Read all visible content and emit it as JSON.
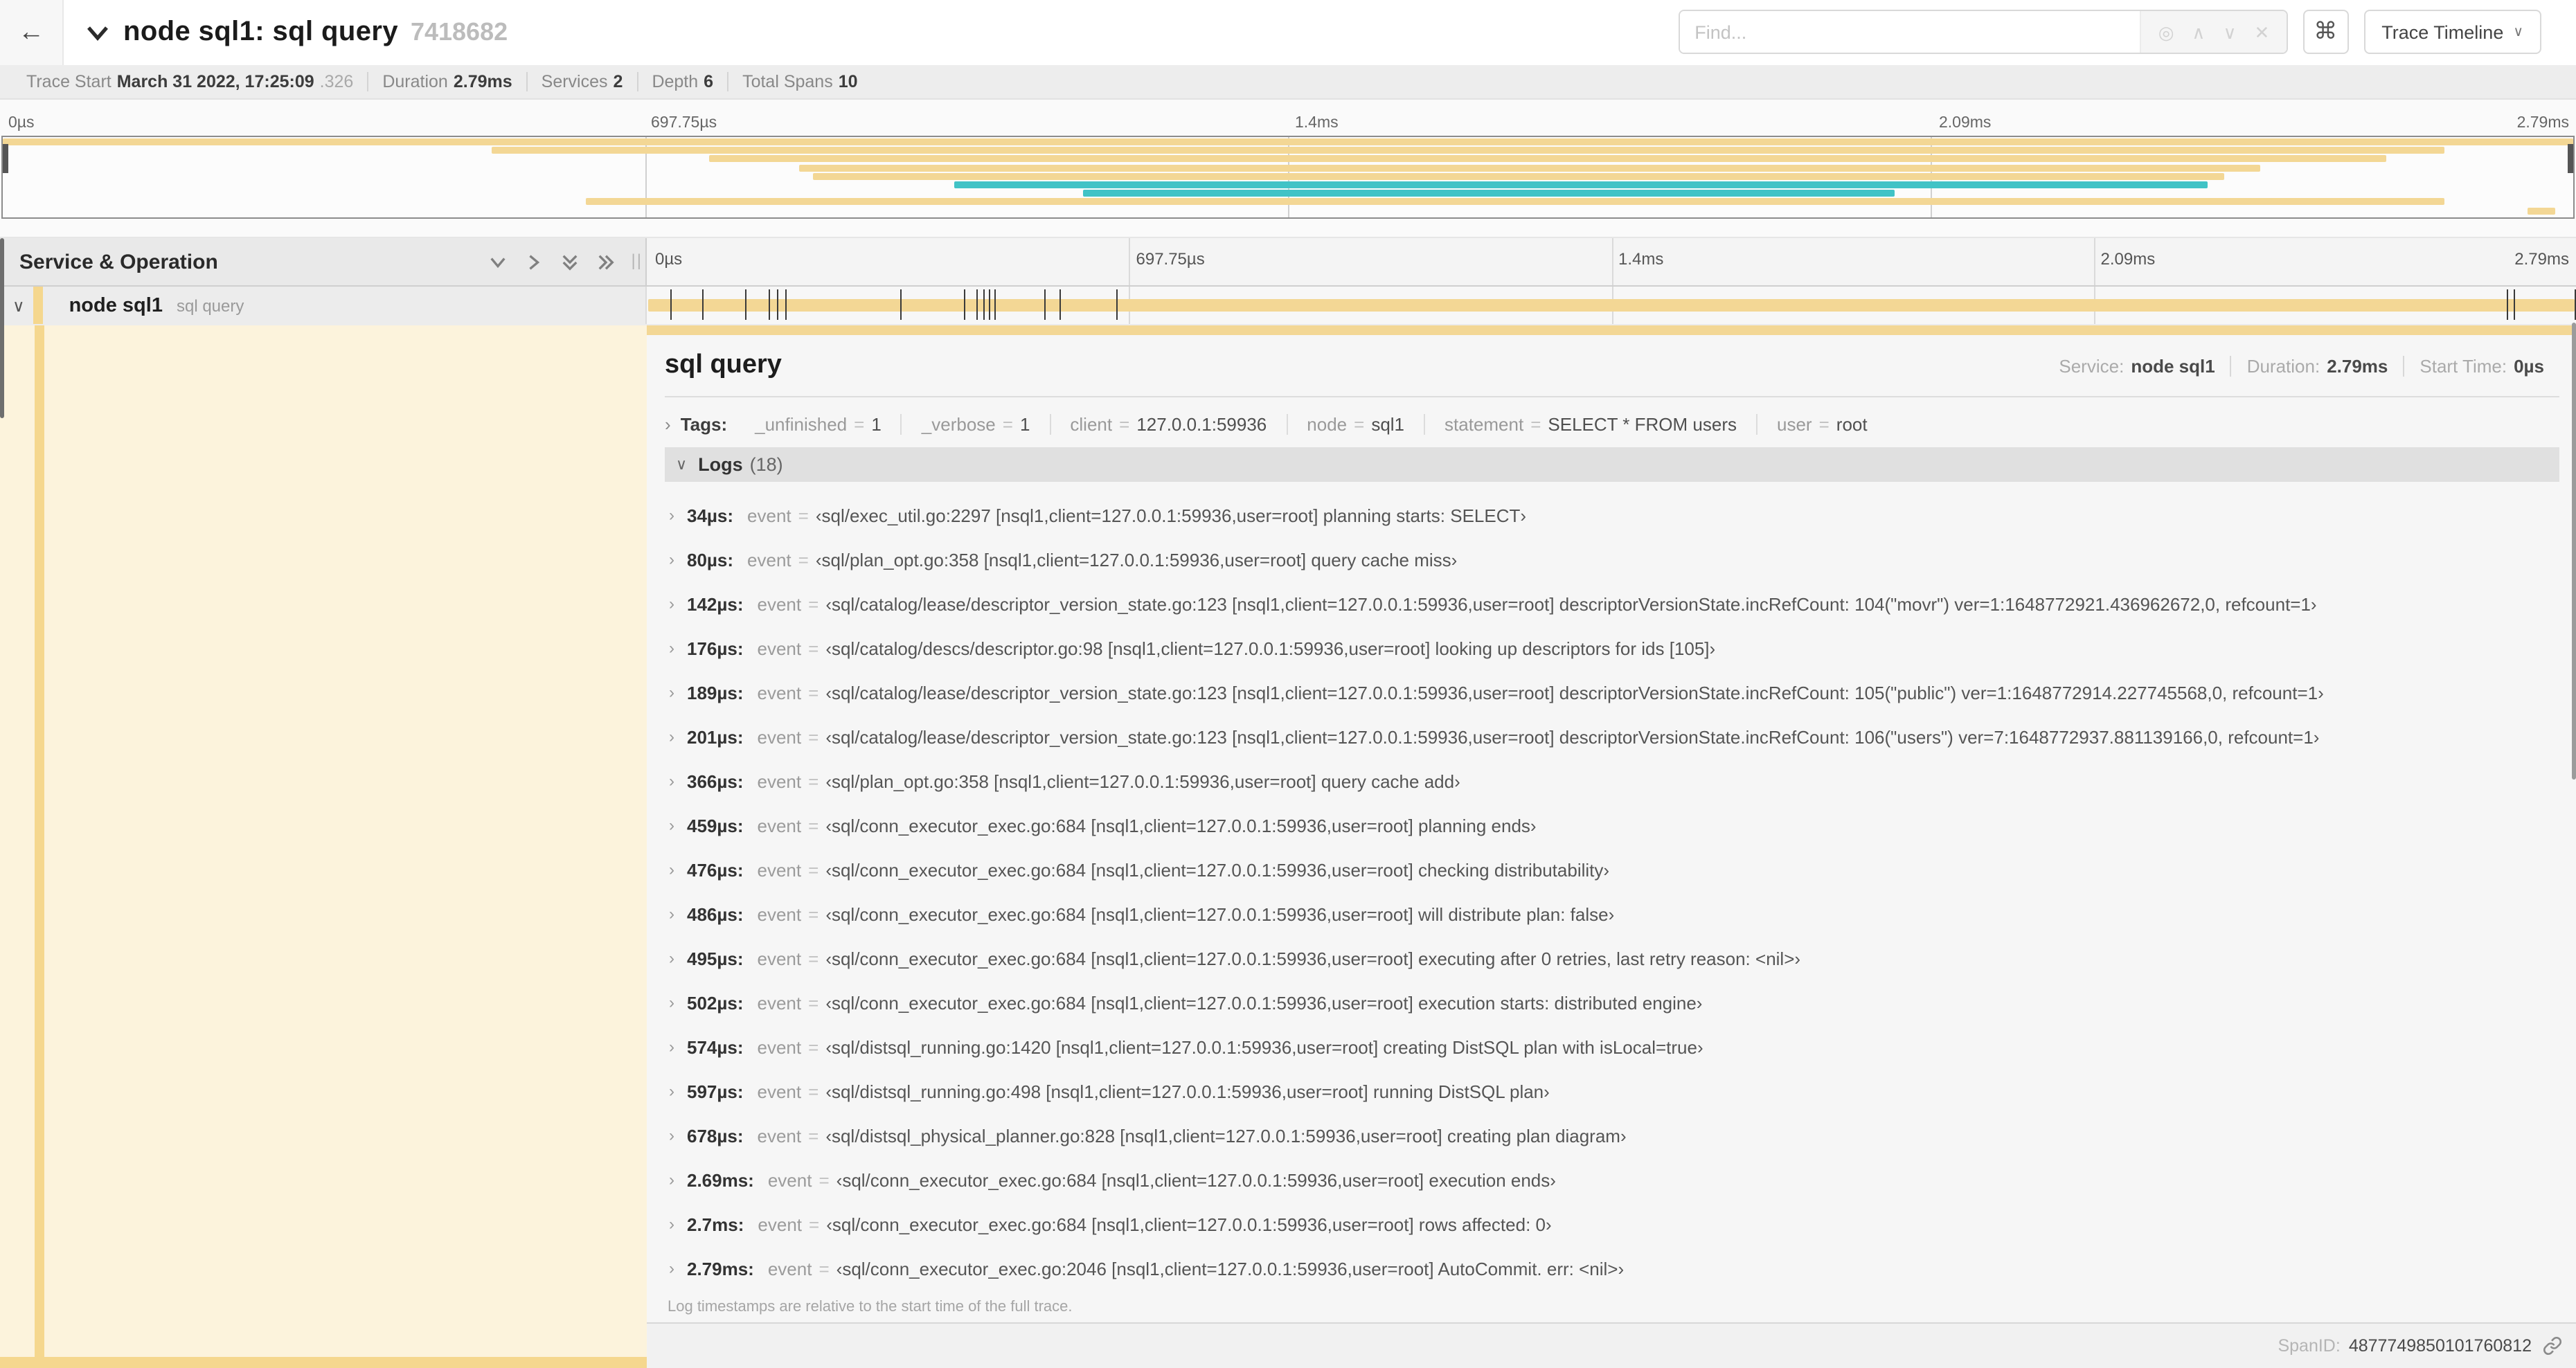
{
  "colors": {
    "tan": "#F3D795",
    "teal": "#41C3C6",
    "stripe": "#F5D78E",
    "cream": "#FCF3DC",
    "marker": "#3a3a3a"
  },
  "icons": {
    "back": "←",
    "target": "◎",
    "up": "∧",
    "down": "∨",
    "clear": "✕",
    "command": "⌘",
    "caret": "∨",
    "chevron_right": "›",
    "chevron_down": "∨"
  },
  "header": {
    "title": "node sql1: sql query",
    "trace_id": "7418682",
    "find_placeholder": "Find...",
    "view_selector": "Trace Timeline"
  },
  "trace_meta": [
    {
      "label": "Trace Start",
      "value": "March 31 2022, 17:25:09",
      "suffix": ".326"
    },
    {
      "label": "Duration",
      "value": "2.79ms",
      "suffix": ""
    },
    {
      "label": "Services",
      "value": "2",
      "suffix": ""
    },
    {
      "label": "Depth",
      "value": "6",
      "suffix": ""
    },
    {
      "label": "Total Spans",
      "value": "10",
      "suffix": ""
    }
  ],
  "ticks": [
    {
      "label": "0µs",
      "pct": 0
    },
    {
      "label": "697.75µs",
      "pct": 25
    },
    {
      "label": "1.4ms",
      "pct": 50
    },
    {
      "label": "2.09ms",
      "pct": 75
    },
    {
      "label": "2.79ms",
      "pct": 100
    }
  ],
  "minimap": {
    "spans": [
      {
        "start": 0,
        "end": 100,
        "color": "tan"
      },
      {
        "start": 19,
        "end": 95,
        "color": "tan"
      },
      {
        "start": 27.5,
        "end": 92.7,
        "color": "tan"
      },
      {
        "start": 31,
        "end": 87.8,
        "color": "tan"
      },
      {
        "start": 31.5,
        "end": 86.4,
        "color": "tan"
      },
      {
        "start": 37,
        "end": 85.8,
        "color": "teal"
      },
      {
        "start": 42,
        "end": 73.6,
        "color": "teal"
      },
      {
        "start": 22.7,
        "end": 95,
        "color": "tan"
      },
      {
        "start": 98.2,
        "end": 99.3,
        "color": "tan"
      }
    ]
  },
  "timeline": {
    "left_header": "Service & Operation",
    "row": {
      "service": "node sql1",
      "operation": "sql query"
    },
    "duration_us": 2790,
    "log_marker_us": [
      34,
      80,
      142,
      176,
      189,
      201,
      366,
      459,
      476,
      486,
      495,
      502,
      574,
      597,
      678,
      2690,
      2700,
      2790
    ]
  },
  "detail": {
    "title": "sql query",
    "eq": "=",
    "info": [
      {
        "label": "Service:",
        "value": "node sql1"
      },
      {
        "label": "Duration:",
        "value": "2.79ms"
      },
      {
        "label": "Start Time:",
        "value": "0µs"
      }
    ],
    "tags_label": "Tags:",
    "tags": [
      {
        "key": "_unfinished",
        "value": "1"
      },
      {
        "key": "_verbose",
        "value": "1"
      },
      {
        "key": "client",
        "value": "127.0.0.1:59936"
      },
      {
        "key": "node",
        "value": "sql1"
      },
      {
        "key": "statement",
        "value": "SELECT * FROM users"
      },
      {
        "key": "user",
        "value": "root"
      }
    ],
    "logs_label": "Logs",
    "logs_count": "(18)",
    "logs": [
      {
        "time": "34µs:",
        "key": "event",
        "value": "‹sql/exec_util.go:2297 [nsql1,client=127.0.0.1:59936,user=root] planning starts: SELECT›"
      },
      {
        "time": "80µs:",
        "key": "event",
        "value": "‹sql/plan_opt.go:358 [nsql1,client=127.0.0.1:59936,user=root] query cache miss›"
      },
      {
        "time": "142µs:",
        "key": "event",
        "value": "‹sql/catalog/lease/descriptor_version_state.go:123 [nsql1,client=127.0.0.1:59936,user=root] descriptorVersionState.incRefCount: 104(\"movr\") ver=1:1648772921.436962672,0, refcount=1›"
      },
      {
        "time": "176µs:",
        "key": "event",
        "value": "‹sql/catalog/descs/descriptor.go:98 [nsql1,client=127.0.0.1:59936,user=root] looking up descriptors for ids [105]›"
      },
      {
        "time": "189µs:",
        "key": "event",
        "value": "‹sql/catalog/lease/descriptor_version_state.go:123 [nsql1,client=127.0.0.1:59936,user=root] descriptorVersionState.incRefCount: 105(\"public\") ver=1:1648772914.227745568,0, refcount=1›"
      },
      {
        "time": "201µs:",
        "key": "event",
        "value": "‹sql/catalog/lease/descriptor_version_state.go:123 [nsql1,client=127.0.0.1:59936,user=root] descriptorVersionState.incRefCount: 106(\"users\") ver=7:1648772937.881139166,0, refcount=1›"
      },
      {
        "time": "366µs:",
        "key": "event",
        "value": "‹sql/plan_opt.go:358 [nsql1,client=127.0.0.1:59936,user=root] query cache add›"
      },
      {
        "time": "459µs:",
        "key": "event",
        "value": "‹sql/conn_executor_exec.go:684 [nsql1,client=127.0.0.1:59936,user=root] planning ends›"
      },
      {
        "time": "476µs:",
        "key": "event",
        "value": "‹sql/conn_executor_exec.go:684 [nsql1,client=127.0.0.1:59936,user=root] checking distributability›"
      },
      {
        "time": "486µs:",
        "key": "event",
        "value": "‹sql/conn_executor_exec.go:684 [nsql1,client=127.0.0.1:59936,user=root] will distribute plan: false›"
      },
      {
        "time": "495µs:",
        "key": "event",
        "value": "‹sql/conn_executor_exec.go:684 [nsql1,client=127.0.0.1:59936,user=root] executing after 0 retries, last retry reason: <nil>›"
      },
      {
        "time": "502µs:",
        "key": "event",
        "value": "‹sql/conn_executor_exec.go:684 [nsql1,client=127.0.0.1:59936,user=root] execution starts: distributed engine›"
      },
      {
        "time": "574µs:",
        "key": "event",
        "value": "‹sql/distsql_running.go:1420 [nsql1,client=127.0.0.1:59936,user=root] creating DistSQL plan with isLocal=true›"
      },
      {
        "time": "597µs:",
        "key": "event",
        "value": "‹sql/distsql_running.go:498 [nsql1,client=127.0.0.1:59936,user=root] running DistSQL plan›"
      },
      {
        "time": "678µs:",
        "key": "event",
        "value": "‹sql/distsql_physical_planner.go:828 [nsql1,client=127.0.0.1:59936,user=root] creating plan diagram›"
      },
      {
        "time": "2.69ms:",
        "key": "event",
        "value": "‹sql/conn_executor_exec.go:684 [nsql1,client=127.0.0.1:59936,user=root] execution ends›"
      },
      {
        "time": "2.7ms:",
        "key": "event",
        "value": "‹sql/conn_executor_exec.go:684 [nsql1,client=127.0.0.1:59936,user=root] rows affected: 0›"
      },
      {
        "time": "2.79ms:",
        "key": "event",
        "value": "‹sql/conn_executor_exec.go:2046 [nsql1,client=127.0.0.1:59936,user=root] AutoCommit. err: <nil>›"
      }
    ],
    "note": "Log timestamps are relative to the start time of the full trace.",
    "footer": {
      "label": "SpanID:",
      "value": "4877749850101760812"
    }
  }
}
